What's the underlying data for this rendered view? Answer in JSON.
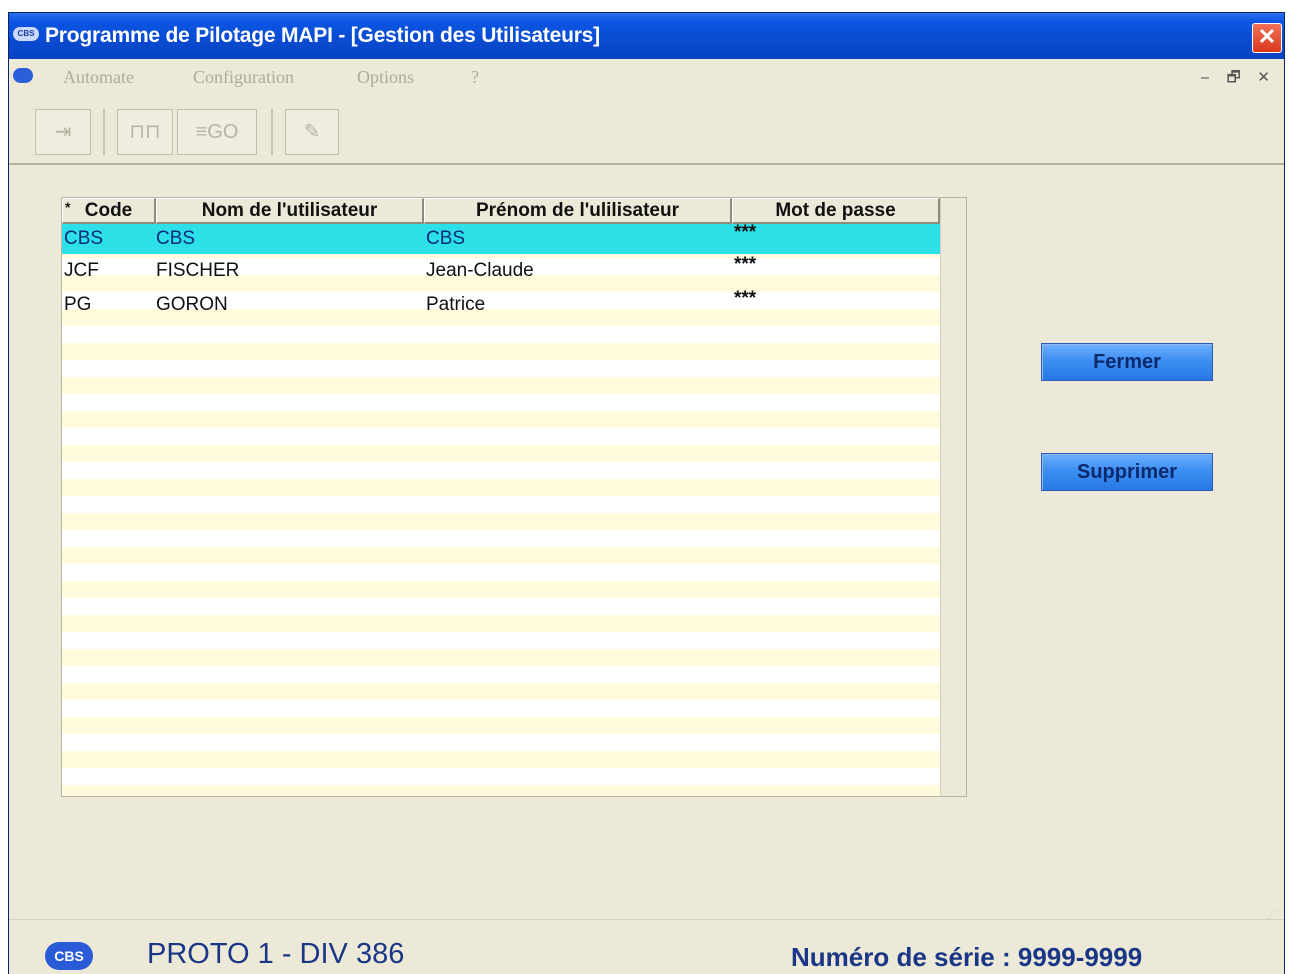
{
  "window": {
    "app_icon_text": "CBS",
    "title": "Programme de Pilotage MAPI - [Gestion des Utilisateurs]",
    "close_glyph": "✕"
  },
  "menubar": {
    "items": [
      "Automate",
      "Configuration",
      "Options",
      "?"
    ],
    "mdi_controls": "‒ 🗗 ✕"
  },
  "toolbar": {
    "buttons": [
      {
        "name": "exit-icon",
        "glyph": "⇥"
      },
      {
        "name": "connect-icon",
        "glyph": "⊓⊓"
      },
      {
        "name": "go-icon",
        "glyph": "≡GO"
      },
      {
        "name": "edit-icon",
        "glyph": "✎"
      }
    ]
  },
  "grid": {
    "columns": [
      "Code",
      "Nom de l'utilisateur",
      "Prénom de l'ulilisateur",
      "Mot de passe"
    ],
    "sort_marker": "*",
    "rows": [
      {
        "code": "CBS",
        "nom": "CBS",
        "prenom": "CBS",
        "mdp": "***",
        "selected": true
      },
      {
        "code": "JCF",
        "nom": "FISCHER",
        "prenom": "Jean-Claude",
        "mdp": "***",
        "selected": false
      },
      {
        "code": "PG",
        "nom": "GORON",
        "prenom": "Patrice",
        "mdp": "***",
        "selected": false
      }
    ]
  },
  "actions": {
    "close_label": "Fermer",
    "delete_label": "Supprimer"
  },
  "status": {
    "logo_text": "CBS",
    "left": "PROTO 1 - DIV 386",
    "right": "Numéro de série : 9999-9999"
  },
  "colors": {
    "selected_row": "#2de0e8",
    "stripe": "#fffbdc",
    "title_blue": "#0b55e2",
    "status_text": "#1a3686"
  }
}
